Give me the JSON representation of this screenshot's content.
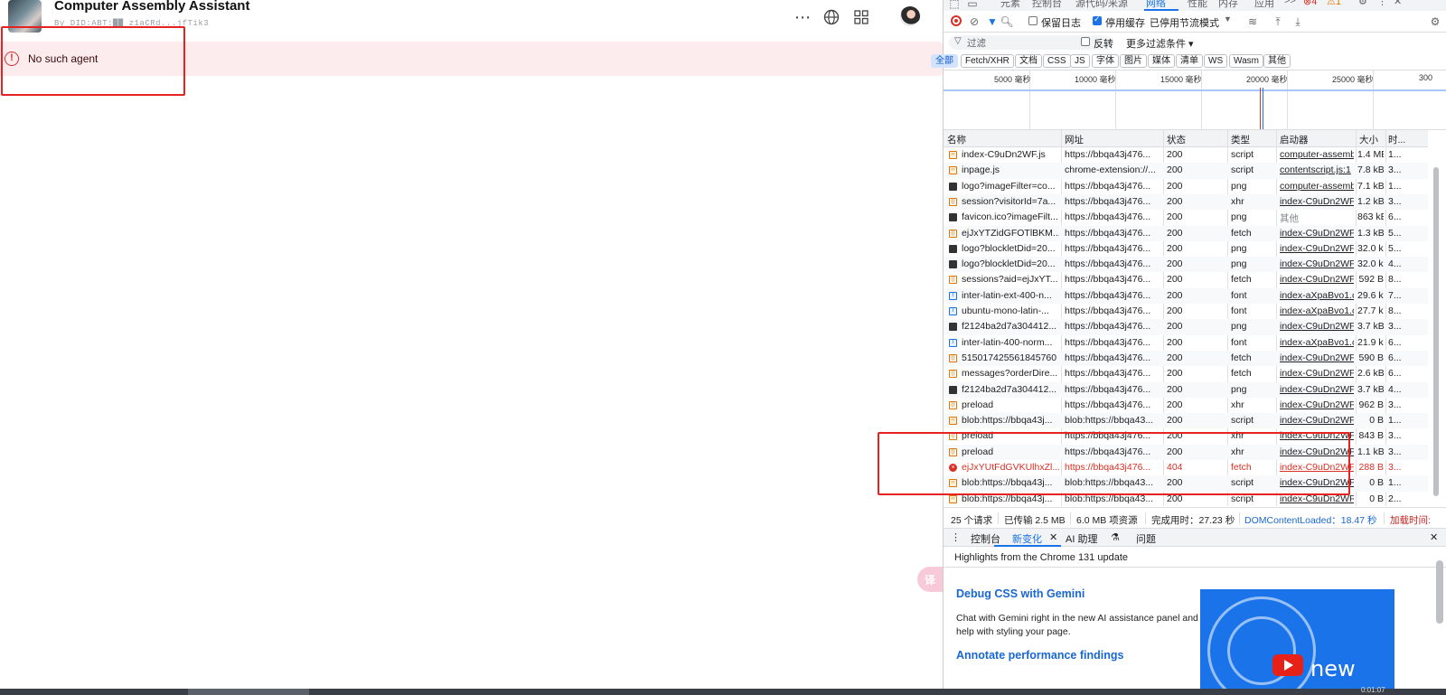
{
  "app": {
    "title": "Computer Assembly Assistant",
    "subtitle": "By DID:ABT:██ z1aCRd...jfTik3",
    "error_message": "No such agent",
    "translate_fab": "译"
  },
  "devtools": {
    "tabs": [
      "元素",
      "控制台",
      "源代码/来源",
      "网络",
      "性能",
      "内存",
      "应用",
      ">>"
    ],
    "active_tab": "网络",
    "badges": {
      "errors": "4",
      "warnings": "1"
    },
    "toolbar": {
      "preserve_log": "保留日志",
      "disable_cache": "停用缓存",
      "throttling": "已停用节流模式"
    },
    "filter": {
      "placeholder": "过滤",
      "invert": "反转",
      "more_filters": "更多过滤条件"
    },
    "type_chips": [
      "全部",
      "Fetch/XHR",
      "文档",
      "CSS",
      "JS",
      "字体",
      "图片",
      "媒体",
      "清单",
      "WS",
      "Wasm",
      "其他"
    ],
    "overview_ticks": [
      "5000 毫秒",
      "10000 毫秒",
      "15000 毫秒",
      "20000 毫秒",
      "25000 毫秒",
      "300"
    ],
    "columns": [
      "名称",
      "网址",
      "状态",
      "类型",
      "启动器",
      "大小",
      "时..."
    ],
    "rows": [
      {
        "icon": "script",
        "name": "index-C9uDn2WF.js",
        "url": "https://bbqa43j476...",
        "status": "200",
        "type": "script",
        "initiator": "computer-assemb",
        "size": "1.4 MB",
        "time": "1..."
      },
      {
        "icon": "script",
        "name": "inpage.js",
        "url": "chrome-extension://...",
        "status": "200",
        "type": "script",
        "initiator": "contentscript.js:1",
        "size": "7.8 kB",
        "time": "3..."
      },
      {
        "icon": "png",
        "name": "logo?imageFilter=co...",
        "url": "https://bbqa43j476...",
        "status": "200",
        "type": "png",
        "initiator": "computer-assemb",
        "size": "7.1 kB",
        "time": "1..."
      },
      {
        "icon": "fetch",
        "name": "session?visitorId=7a...",
        "url": "https://bbqa43j476...",
        "status": "200",
        "type": "xhr",
        "initiator": "index-C9uDn2WF.",
        "size": "1.2 kB",
        "time": "3..."
      },
      {
        "icon": "png",
        "name": "favicon.ico?imageFilt...",
        "url": "https://bbqa43j476...",
        "status": "200",
        "type": "png",
        "initiator": "其他",
        "size": "863 kB",
        "time": "6..."
      },
      {
        "icon": "fetch",
        "name": "ejJxYTZidGFOTlBKM...",
        "url": "https://bbqa43j476...",
        "status": "200",
        "type": "fetch",
        "initiator": "index-C9uDn2WF.",
        "size": "1.3 kB",
        "time": "5..."
      },
      {
        "icon": "png",
        "name": "logo?blockletDid=20...",
        "url": "https://bbqa43j476...",
        "status": "200",
        "type": "png",
        "initiator": "index-C9uDn2WF.",
        "size": "32.0 kB",
        "time": "5..."
      },
      {
        "icon": "png",
        "name": "logo?blockletDid=20...",
        "url": "https://bbqa43j476...",
        "status": "200",
        "type": "png",
        "initiator": "index-C9uDn2WF.",
        "size": "32.0 kB",
        "time": "4..."
      },
      {
        "icon": "fetch",
        "name": "sessions?aid=ejJxYT...",
        "url": "https://bbqa43j476...",
        "status": "200",
        "type": "fetch",
        "initiator": "index-C9uDn2WF.",
        "size": "592 B",
        "time": "8..."
      },
      {
        "icon": "font",
        "name": "inter-latin-ext-400-n...",
        "url": "https://bbqa43j476...",
        "status": "200",
        "type": "font",
        "initiator": "index-aXpaBvo1.c",
        "size": "29.6 kB",
        "time": "7..."
      },
      {
        "icon": "font",
        "name": "ubuntu-mono-latin-...",
        "url": "https://bbqa43j476...",
        "status": "200",
        "type": "font",
        "initiator": "index-aXpaBvo1.c",
        "size": "27.7 kB",
        "time": "8..."
      },
      {
        "icon": "png",
        "name": "f2124ba2d7a304412...",
        "url": "https://bbqa43j476...",
        "status": "200",
        "type": "png",
        "initiator": "index-C9uDn2WF.",
        "size": "3.7 kB",
        "time": "3..."
      },
      {
        "icon": "font",
        "name": "inter-latin-400-norm...",
        "url": "https://bbqa43j476...",
        "status": "200",
        "type": "font",
        "initiator": "index-aXpaBvo1.c",
        "size": "21.9 kB",
        "time": "6..."
      },
      {
        "icon": "fetch",
        "name": "515017425561845760",
        "url": "https://bbqa43j476...",
        "status": "200",
        "type": "fetch",
        "initiator": "index-C9uDn2WF.",
        "size": "590 B",
        "time": "6..."
      },
      {
        "icon": "fetch",
        "name": "messages?orderDire...",
        "url": "https://bbqa43j476...",
        "status": "200",
        "type": "fetch",
        "initiator": "index-C9uDn2WF.",
        "size": "2.6 kB",
        "time": "6..."
      },
      {
        "icon": "png",
        "name": "f2124ba2d7a304412...",
        "url": "https://bbqa43j476...",
        "status": "200",
        "type": "png",
        "initiator": "index-C9uDn2WF.",
        "size": "3.7 kB",
        "time": "4..."
      },
      {
        "icon": "fetch",
        "name": "preload",
        "url": "https://bbqa43j476...",
        "status": "200",
        "type": "xhr",
        "initiator": "index-C9uDn2WF.",
        "size": "962 B",
        "time": "3..."
      },
      {
        "icon": "script",
        "name": "blob:https://bbqa43j...",
        "url": "blob:https://bbqa43...",
        "status": "200",
        "type": "script",
        "initiator": "index-C9uDn2WF.",
        "size": "0 B",
        "time": "1..."
      },
      {
        "icon": "fetch",
        "name": "preload",
        "url": "https://bbqa43j476...",
        "status": "200",
        "type": "xhr",
        "initiator": "index-C9uDn2WF.",
        "size": "843 B",
        "time": "3..."
      },
      {
        "icon": "fetch",
        "name": "preload",
        "url": "https://bbqa43j476...",
        "status": "200",
        "type": "xhr",
        "initiator": "index-C9uDn2WF.",
        "size": "1.1 kB",
        "time": "3..."
      },
      {
        "icon": "err",
        "name": "ejJxYUtFdGVKUlhxZl...",
        "url": "https://bbqa43j476...",
        "status": "404",
        "type": "fetch",
        "initiator": "index-C9uDn2WF.",
        "size": "288 B",
        "time": "3..."
      },
      {
        "icon": "script",
        "name": "blob:https://bbqa43j...",
        "url": "blob:https://bbqa43...",
        "status": "200",
        "type": "script",
        "initiator": "index-C9uDn2WF.",
        "size": "0 B",
        "time": "1..."
      },
      {
        "icon": "script",
        "name": "blob:https://bbqa43j...",
        "url": "blob:https://bbqa43...",
        "status": "200",
        "type": "script",
        "initiator": "index-C9uDn2WF.",
        "size": "0 B",
        "time": "2..."
      }
    ],
    "summary": {
      "requests": "25 个请求",
      "transferred": "已传输 2.5 MB",
      "resources": "6.0 MB 项资源",
      "finish": "完成用时：27.23 秒",
      "dcl": "DOMContentLoaded：18.47 秒",
      "load": "加载时间:"
    },
    "drawer_tabs": [
      "控制台",
      "新变化",
      "AI 助理",
      "问题"
    ],
    "whats_new": {
      "highlights": "Highlights from the Chrome 131 update",
      "h1": "Debug CSS with Gemini",
      "p1": "Chat with Gemini right in the new AI assistance panel and get help with styling your page.",
      "h2": "Annotate performance findings",
      "video_label": "new"
    }
  },
  "taskbar": {
    "clock": "0:01:07"
  }
}
